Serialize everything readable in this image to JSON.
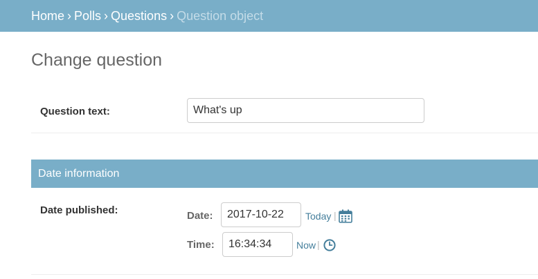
{
  "breadcrumbs": {
    "home": "Home",
    "polls": "Polls",
    "questions": "Questions",
    "current": "Question object",
    "separator": "›"
  },
  "page": {
    "title": "Change question"
  },
  "question": {
    "label": "Question text:",
    "value": "What's up"
  },
  "date_section": {
    "header": "Date information",
    "label": "Date published:",
    "date_label": "Date:",
    "date_value": "2017-10-22",
    "today_link": "Today",
    "time_label": "Time:",
    "time_value": "16:34:34",
    "now_link": "Now",
    "pipe": "|"
  },
  "icons": {
    "calendar": "calendar-icon",
    "clock": "clock-icon"
  },
  "colors": {
    "header": "#79aec8",
    "link": "#447e9b"
  }
}
